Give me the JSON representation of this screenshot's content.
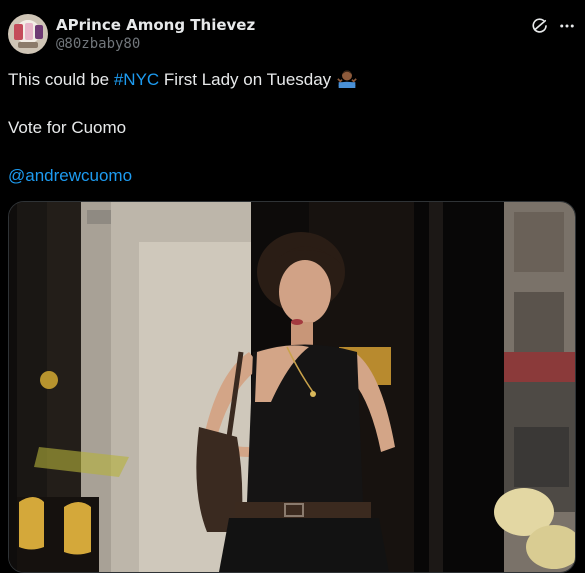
{
  "tweet": {
    "author": {
      "display_name": "APrince Among Thievez",
      "handle": "@80zbaby80"
    },
    "text_prefix": "This could be ",
    "hashtag": "#NYC",
    "text_suffix": " First Lady on Tuesday",
    "emoji_name": "person-shrugging-emoji",
    "line2": "Vote for Cuomo",
    "mention": "@andrewcuomo"
  },
  "icons": {
    "header_action": "grok-icon",
    "menu": "more-horizontal-icon"
  },
  "colors": {
    "background": "#000000",
    "text": "#e7e9ea",
    "secondary_text": "#71767b",
    "link": "#1d9bf0"
  }
}
